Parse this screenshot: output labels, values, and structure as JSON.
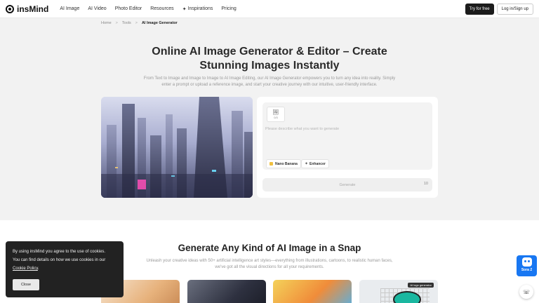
{
  "header": {
    "logo_text": "insMind",
    "nav": [
      {
        "label": "AI Image"
      },
      {
        "label": "AI Video"
      },
      {
        "label": "Photo Editor"
      },
      {
        "label": "Resources"
      },
      {
        "label": "Inspirations",
        "icon": "sparkle-icon"
      },
      {
        "label": "Pricing"
      }
    ],
    "try_label": "Try for free",
    "login_label": "Log in/Sign up"
  },
  "breadcrumb": {
    "home": "Home",
    "tools": "Tools",
    "current": "AI Image Generator",
    "separator": ">"
  },
  "hero": {
    "title_line1": "Online AI Image Generator & Editor – Create",
    "title_line2": "Stunning Images Instantly",
    "desc_line1": "From Text to Image and Image to Image to AI Image Editing, our AI Image Generator empowers you to turn any idea into reality. Simply",
    "desc_line2": "enter a prompt or upload a reference image, and start your creative journey with our intuitive, user-friendly interface."
  },
  "generator": {
    "upload_label": "0/3",
    "prompt_placeholder": "Please describe what you want to generate",
    "model_chip": "Nano Banana",
    "enhancer_chip": "Enhancer",
    "generate_label": "Generate",
    "credit_label": "10"
  },
  "section2": {
    "title": "Generate Any Kind of AI Image in a Snap",
    "desc_line1": "Unleash your creative ideas with 50+ artificial intelligence art styles—everything from illustrations, cartoons, to realistic human faces,",
    "desc_line2": "we've got all the visual directions for all your requirements.",
    "card4_tag": "AI logo generator"
  },
  "cookie": {
    "line1": "By using insMind you agree to the use of cookies.",
    "line2": "You can find details on how we use cookies in our",
    "policy_link": "Cookie Policy",
    "policy_suffix": ".",
    "close_label": "Close"
  },
  "widget": {
    "sora_label": "Sora 2"
  },
  "colors": {
    "accent_dark": "#1c1c1c",
    "sora_blue": "#1877f2",
    "page_bg": "#f2f2f2"
  }
}
